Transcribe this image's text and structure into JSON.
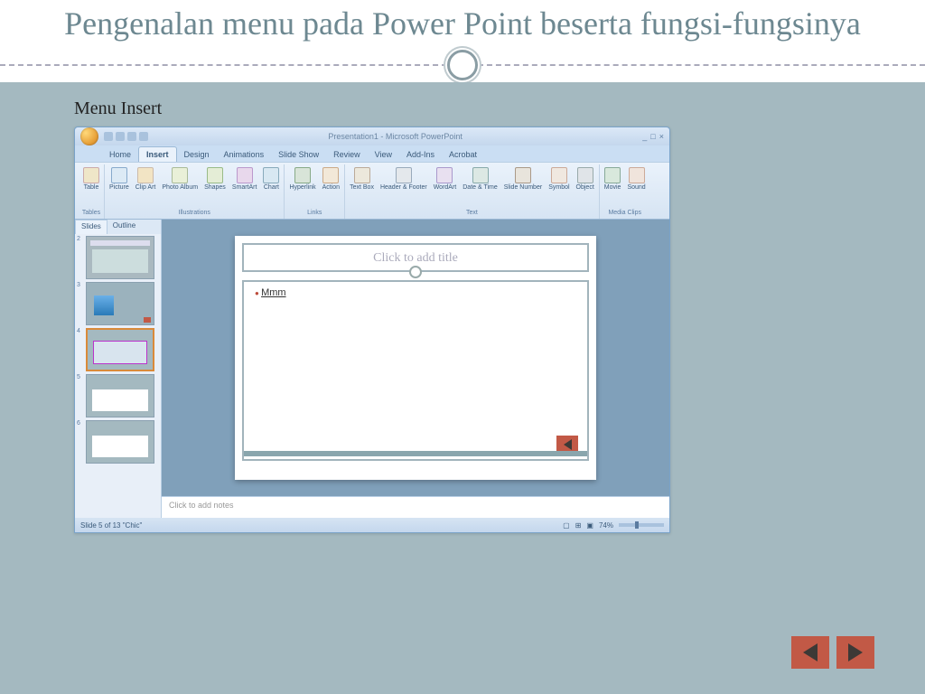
{
  "title": "Pengenalan menu pada Power Point beserta fungsi-fungsinya",
  "section": "Menu Insert",
  "pp": {
    "titlebar": "Presentation1 - Microsoft PowerPoint",
    "tabs": [
      "Home",
      "Insert",
      "Design",
      "Animations",
      "Slide Show",
      "Review",
      "View",
      "Add-Ins",
      "Acrobat"
    ],
    "active_tab": "Insert",
    "ribbon_groups": [
      {
        "label": "Tables",
        "items": [
          {
            "t": "Table",
            "c": "ic-tb"
          }
        ]
      },
      {
        "label": "Illustrations",
        "items": [
          {
            "t": "Picture",
            "c": "ic-pi"
          },
          {
            "t": "Clip Art",
            "c": "ic-ca"
          },
          {
            "t": "Photo Album",
            "c": "ic-pa"
          },
          {
            "t": "Shapes",
            "c": "ic-sh"
          },
          {
            "t": "SmartArt",
            "c": "ic-sa"
          },
          {
            "t": "Chart",
            "c": "ic-ch"
          }
        ]
      },
      {
        "label": "Links",
        "items": [
          {
            "t": "Hyperlink",
            "c": "ic-hy"
          },
          {
            "t": "Action",
            "c": "ic-ac"
          }
        ]
      },
      {
        "label": "Text",
        "items": [
          {
            "t": "Text Box",
            "c": "ic-tx"
          },
          {
            "t": "Header & Footer",
            "c": "ic-hf"
          },
          {
            "t": "WordArt",
            "c": "ic-wa"
          },
          {
            "t": "Date & Time",
            "c": "ic-dt"
          },
          {
            "t": "Slide Number",
            "c": "ic-sn"
          },
          {
            "t": "Symbol",
            "c": "ic-sy"
          },
          {
            "t": "Object",
            "c": "ic-ob"
          }
        ]
      },
      {
        "label": "Media Clips",
        "items": [
          {
            "t": "Movie",
            "c": "ic-mv"
          },
          {
            "t": "Sound",
            "c": "ic-so"
          }
        ]
      }
    ],
    "thumb_tabs": [
      "Slides",
      "Outline"
    ],
    "thumbs": [
      {
        "n": "2",
        "cls": "th2"
      },
      {
        "n": "3",
        "cls": "th3"
      },
      {
        "n": "4",
        "cls": "th4",
        "selected": true
      },
      {
        "n": "5",
        "cls": "th5"
      },
      {
        "n": "6",
        "cls": "th6"
      }
    ],
    "slide_title_placeholder": "Click to add title",
    "slide_bullet": "Mmm",
    "notes_placeholder": "Click to add notes",
    "status_left": "Slide 5 of 13    \"Chic\"",
    "zoom": "74%"
  }
}
